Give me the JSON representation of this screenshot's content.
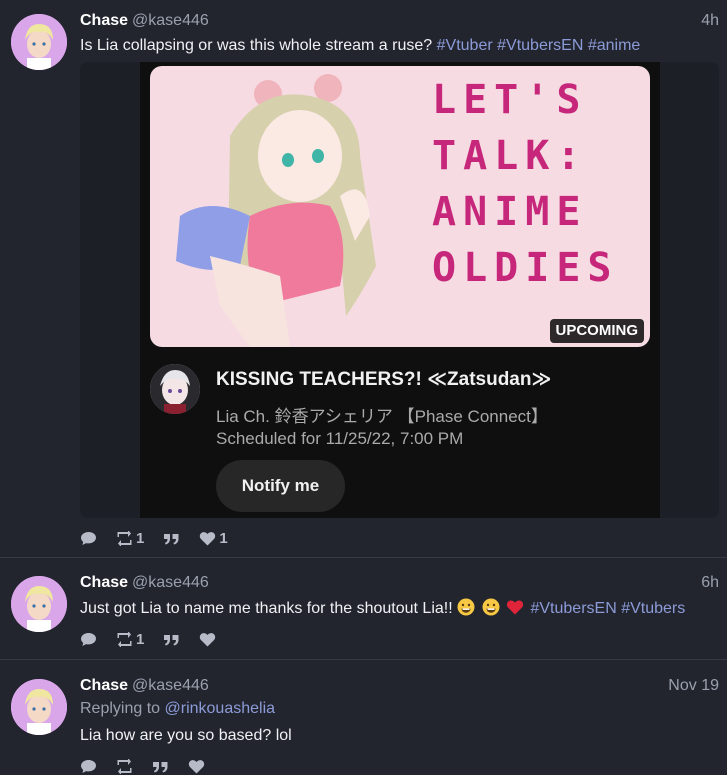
{
  "posts": [
    {
      "name": "Chase",
      "handle": "@kase446",
      "time": "4h",
      "text": "Is Lia collapsing or was this whole stream a ruse?",
      "tags": [
        "#Vtuber",
        "#VtubersEN",
        "#anime"
      ],
      "embed": {
        "thumbnail_lines": [
          "LET'S",
          "TALK:",
          "ANIME",
          "OLDIES"
        ],
        "badge": "UPCOMING",
        "title": "KISSING TEACHERS?! ≪Zatsudan≫",
        "channel": "Lia Ch. 鈴香アシェリア 【Phase Connect】",
        "scheduled": "Scheduled for 11/25/22, 7:00 PM",
        "button": "Notify me"
      },
      "boosts": "1",
      "likes": "1"
    },
    {
      "name": "Chase",
      "handle": "@kase446",
      "time": "6h",
      "text": "Just got Lia to name me thanks for the shoutout Lia!!",
      "tags": [
        "#VtubersEN",
        "#Vtubers"
      ],
      "emojis": [
        "grinning-emoji",
        "grinning-emoji",
        "red-heart-emoji"
      ],
      "boosts": "1",
      "likes": ""
    },
    {
      "name": "Chase",
      "handle": "@kase446",
      "time": "Nov 19",
      "reply_prefix": "Replying to",
      "reply_to": "@rinkouashelia",
      "text": "Lia how are you so based? lol",
      "boosts": "",
      "likes": ""
    }
  ],
  "icons": [
    "reply-icon",
    "boost-icon",
    "quote-icon",
    "like-icon"
  ],
  "colors": {
    "background": "#22252e",
    "accent_link": "#8c9bd8",
    "thumb_text": "#c6277a"
  }
}
